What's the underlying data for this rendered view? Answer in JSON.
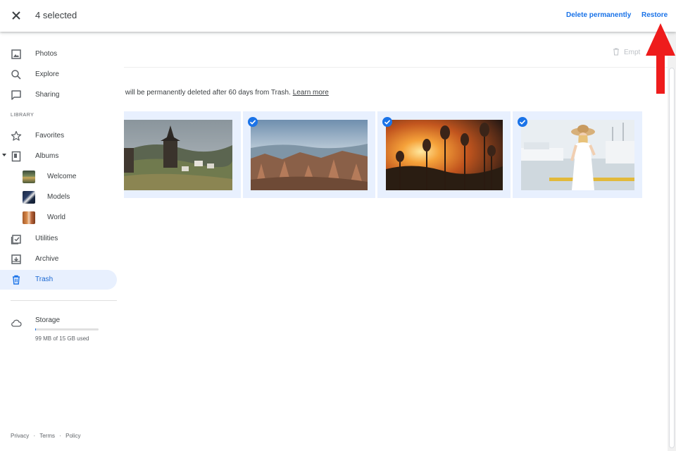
{
  "topbar": {
    "selected_label": "4 selected",
    "delete_label": "Delete permanently",
    "restore_label": "Restore"
  },
  "sidebar": {
    "items": [
      {
        "label": "Photos",
        "icon": "photo-icon"
      },
      {
        "label": "Explore",
        "icon": "search-icon"
      },
      {
        "label": "Sharing",
        "icon": "chat-icon"
      }
    ],
    "library_label": "LIBRARY",
    "library_items": [
      {
        "label": "Favorites",
        "icon": "star-icon"
      },
      {
        "label": "Albums",
        "icon": "album-icon"
      }
    ],
    "albums": [
      {
        "label": "Welcome"
      },
      {
        "label": "Models"
      },
      {
        "label": "World"
      }
    ],
    "more_items": [
      {
        "label": "Utilities",
        "icon": "utilities-icon"
      },
      {
        "label": "Archive",
        "icon": "archive-icon"
      },
      {
        "label": "Trash",
        "icon": "trash-icon",
        "active": true
      }
    ],
    "storage": {
      "label": "Storage",
      "used_text": "99 MB of 15 GB used",
      "fill_fraction": 0.0066
    },
    "footer": {
      "privacy": "Privacy",
      "terms": "Terms",
      "policy": "Policy",
      "separator": "·"
    }
  },
  "main": {
    "empty_trash_label": "Empt",
    "notice_text": "s will be permanently deleted after 60 days from Trash.",
    "learn_more": "Learn more",
    "photos": [
      {
        "description": "church-village",
        "selected": true
      },
      {
        "description": "rock-landscape",
        "selected": true
      },
      {
        "description": "sunset-flowers",
        "selected": true
      },
      {
        "description": "woman-harbor",
        "selected": true
      }
    ]
  },
  "colors": {
    "accent": "#1a73e8",
    "selected_tile_bg": "#e8f0fe",
    "annotation_arrow": "#ee1c1c"
  }
}
